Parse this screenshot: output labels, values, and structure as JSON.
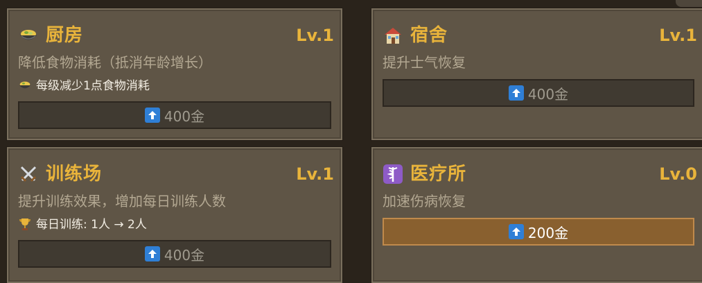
{
  "cards": [
    {
      "id": "kitchen",
      "title": "厨房",
      "level": "Lv.1",
      "description": "降低食物消耗（抵消年龄增长）",
      "effect": "每级减少1点食物消耗",
      "icon": "food-bowl-icon",
      "button_label": "400金",
      "button_state": "disabled"
    },
    {
      "id": "dormitory",
      "title": "宿舍",
      "level": "Lv.1",
      "description": "提升士气恢复",
      "icon": "house-icon",
      "button_label": "400金",
      "button_state": "disabled"
    },
    {
      "id": "training-ground",
      "title": "训练场",
      "level": "Lv.1",
      "description": "提升训练效果，增加每日训练人数",
      "effect": "每日训练: 1人 → 2人",
      "icon": "crossed-swords-icon",
      "effect_icon": "trophy-icon",
      "button_label": "400金",
      "button_state": "disabled"
    },
    {
      "id": "clinic",
      "title": "医疗所",
      "level": "Lv.0",
      "description": "加速伤病恢复",
      "icon": "medical-symbol-icon",
      "button_label": "200金",
      "button_state": "active"
    }
  ],
  "colors": {
    "title": "#e9b43b",
    "card_bg": "#5f5546",
    "button_disabled": "#403a31",
    "button_active": "#89602f",
    "upgrade_icon": "#2f7fd6"
  }
}
